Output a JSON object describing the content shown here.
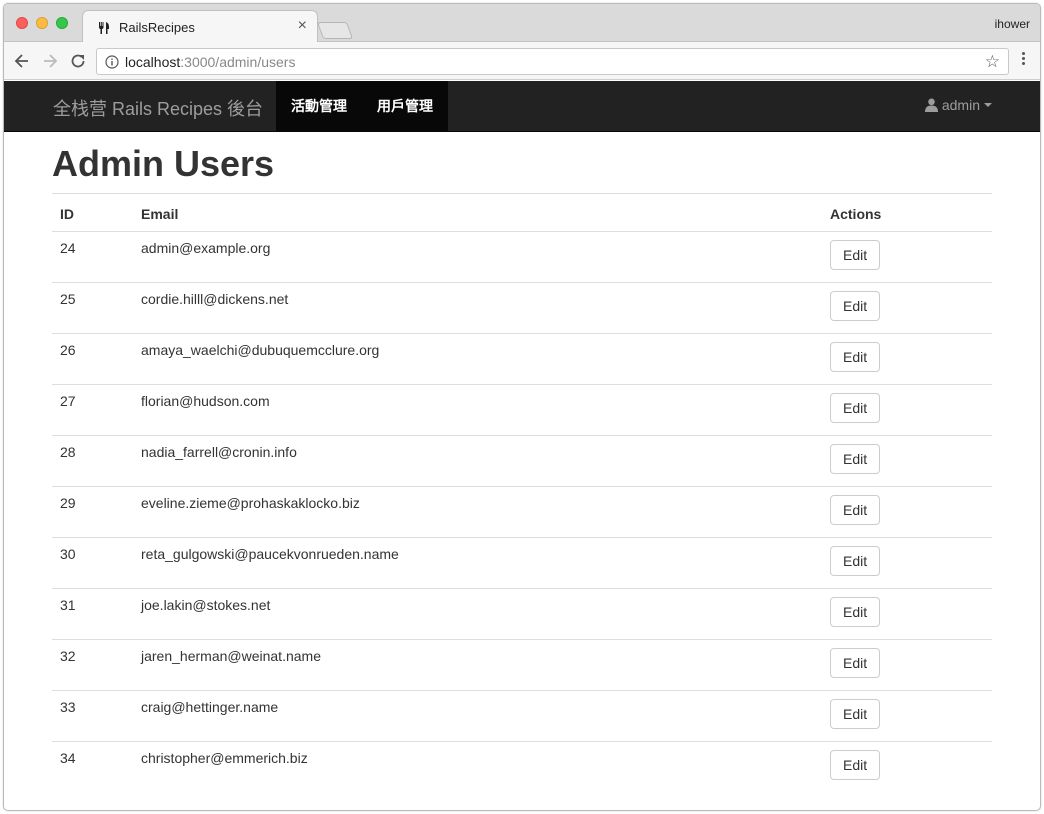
{
  "browser": {
    "tab_title": "RailsRecipes",
    "profile_name": "ihower",
    "url_host": "localhost",
    "url_path": ":3000/admin/users"
  },
  "navbar": {
    "brand": "全栈营 Rails Recipes 後台",
    "items": [
      {
        "label": "活動管理"
      },
      {
        "label": "用戶管理"
      }
    ],
    "user_label": "admin"
  },
  "page": {
    "title": "Admin Users",
    "columns": [
      "ID",
      "Email",
      "Actions"
    ],
    "edit_label": "Edit",
    "rows": [
      {
        "id": "24",
        "email": "admin@example.org"
      },
      {
        "id": "25",
        "email": "cordie.hilll@dickens.net"
      },
      {
        "id": "26",
        "email": "amaya_waelchi@dubuquemcclure.org"
      },
      {
        "id": "27",
        "email": "florian@hudson.com"
      },
      {
        "id": "28",
        "email": "nadia_farrell@cronin.info"
      },
      {
        "id": "29",
        "email": "eveline.zieme@prohaskaklocko.biz"
      },
      {
        "id": "30",
        "email": "reta_gulgowski@paucekvonrueden.name"
      },
      {
        "id": "31",
        "email": "joe.lakin@stokes.net"
      },
      {
        "id": "32",
        "email": "jaren_herman@weinat.name"
      },
      {
        "id": "33",
        "email": "craig@hettinger.name"
      },
      {
        "id": "34",
        "email": "christopher@emmerich.biz"
      }
    ]
  },
  "icons": {
    "favicon": "fork-knife-icon",
    "back": "arrow-left-icon",
    "forward": "arrow-right-icon",
    "reload": "reload-icon",
    "info": "info-icon",
    "bookmark": "star-icon",
    "menu": "menu-dots-icon",
    "user": "user-icon"
  }
}
